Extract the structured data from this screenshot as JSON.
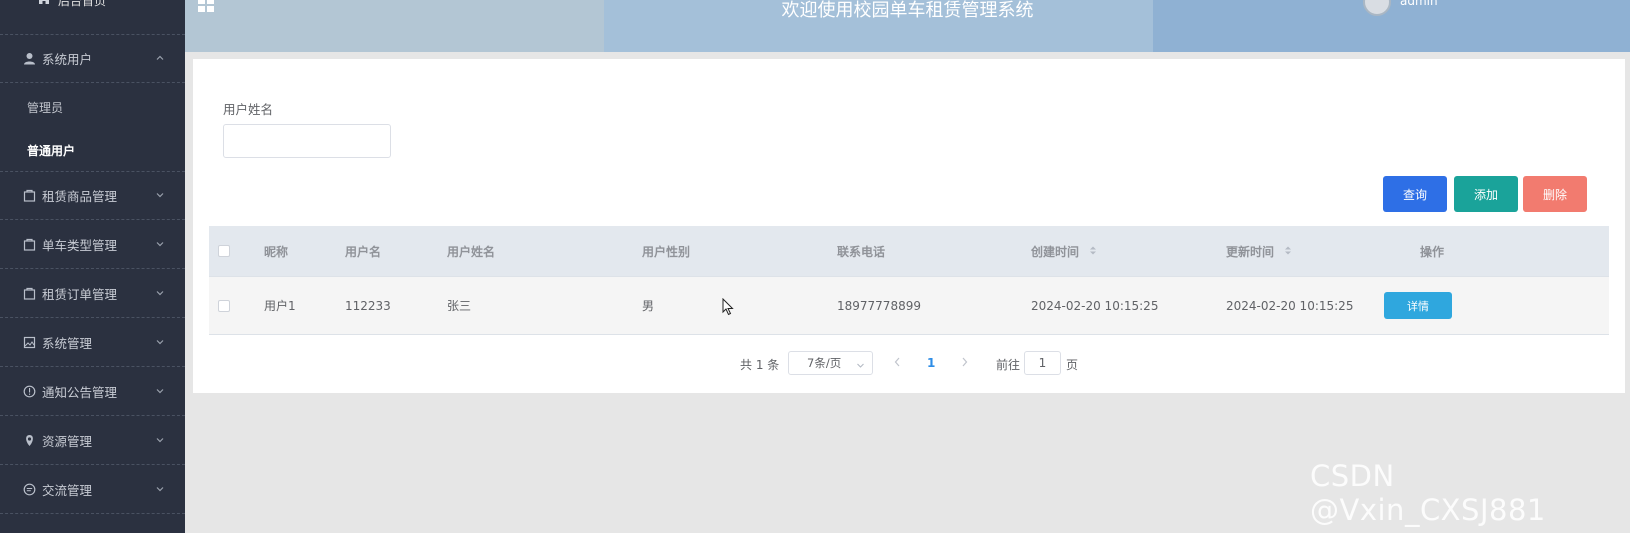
{
  "sidebar": {
    "home_label": "后台首页",
    "groups": [
      {
        "label": "系统用户",
        "icon": "user-icon",
        "expanded": true
      },
      {
        "label": "租赁商品管理",
        "icon": "folder-icon"
      },
      {
        "label": "单车类型管理",
        "icon": "folder-icon"
      },
      {
        "label": "租赁订单管理",
        "icon": "folder-icon"
      },
      {
        "label": "系统管理",
        "icon": "image-icon"
      },
      {
        "label": "通知公告管理",
        "icon": "info-circle-icon"
      },
      {
        "label": "资源管理",
        "icon": "location-icon"
      },
      {
        "label": "交流管理",
        "icon": "chat-icon"
      }
    ],
    "sub_items": [
      {
        "label": "管理员",
        "active": false
      },
      {
        "label": "普通用户",
        "active": true
      }
    ]
  },
  "header": {
    "title": "欢迎使用校园单车租赁管理系统",
    "user": "admin"
  },
  "search": {
    "label": "用户姓名",
    "value": ""
  },
  "actions": {
    "query": "查询",
    "add": "添加",
    "delete": "删除"
  },
  "table": {
    "columns": [
      "昵称",
      "用户名",
      "用户姓名",
      "用户性别",
      "联系电话",
      "创建时间",
      "更新时间",
      "操作"
    ],
    "rows": [
      {
        "nickname": "用户1",
        "username": "112233",
        "realname": "张三",
        "gender": "男",
        "phone": "18977778899",
        "created": "2024-02-20 10:15:25",
        "updated": "2024-02-20 10:15:25",
        "action": "详情"
      }
    ]
  },
  "pagination": {
    "total": "共 1 条",
    "page_size": "7条/页",
    "current": "1",
    "goto_label": "前往",
    "goto_value": "1",
    "page_suffix": "页"
  },
  "watermark": "CSDN @Vxin_CXSJ881",
  "colors": {
    "sidebar_bg": "#2b3140",
    "query_btn": "#2e6fe6",
    "add_btn": "#1aa39a",
    "delete_btn": "#f27b6f",
    "detail_btn": "#2fa7de"
  }
}
